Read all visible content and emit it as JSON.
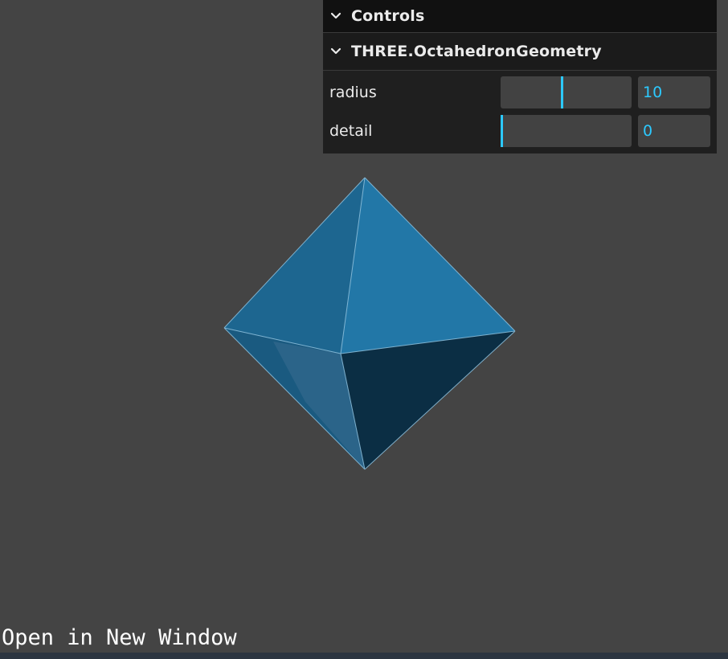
{
  "gui": {
    "title": "Controls",
    "folder": {
      "title": "THREE.OctahedronGeometry",
      "controls": [
        {
          "label": "radius",
          "value": "10",
          "fraction": 0.47
        },
        {
          "label": "detail",
          "value": "0",
          "fraction": 0.0
        }
      ]
    }
  },
  "footer": {
    "link_text": "Open in New Window"
  },
  "colors": {
    "background": "#444444",
    "accent": "#2cc9ff",
    "panel": "#1f1f1f",
    "mesh": "#2177a8"
  },
  "icons": {
    "collapse": "chevron-down-icon"
  }
}
